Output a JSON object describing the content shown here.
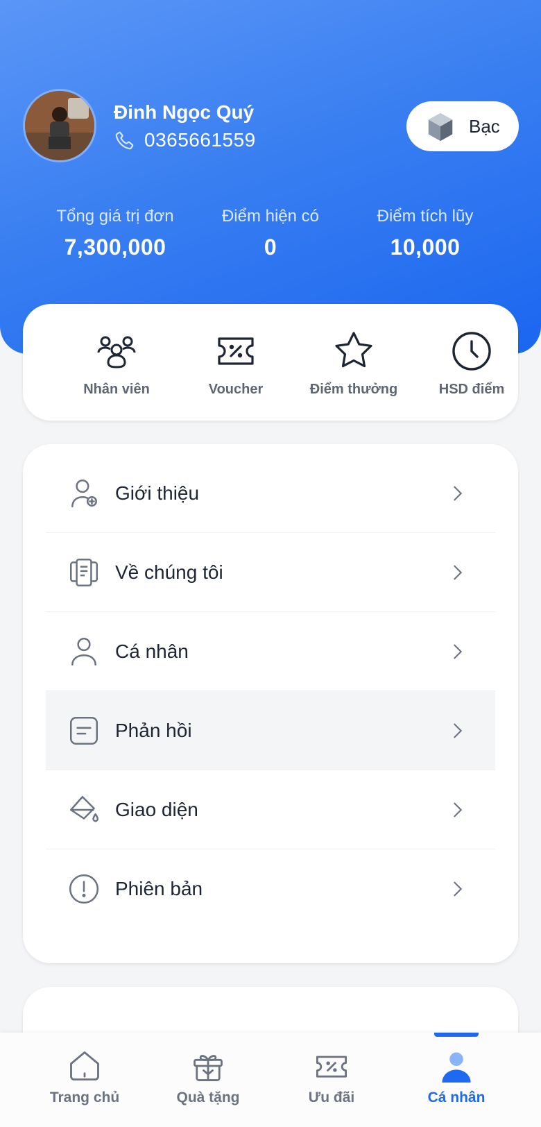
{
  "profile": {
    "name": "Đinh Ngọc Quý",
    "phone": "0365661559",
    "tier": "Bạc",
    "avatar_icon": "user-photo"
  },
  "stats": [
    {
      "label": "Tổng giá trị đơn",
      "value": "7,300,000"
    },
    {
      "label": "Điểm hiện có",
      "value": "0"
    },
    {
      "label": "Điểm tích lũy",
      "value": "10,000"
    }
  ],
  "quick_actions": [
    {
      "label": "Nhân viên",
      "icon": "people-icon"
    },
    {
      "label": "Voucher",
      "icon": "ticket-percent-icon"
    },
    {
      "label": "Điểm thưởng",
      "icon": "star-icon"
    },
    {
      "label": "HSD điểm",
      "icon": "clock-icon"
    }
  ],
  "menu": [
    {
      "label": "Giới thiệu",
      "icon": "user-add-icon"
    },
    {
      "label": "Về chúng tôi",
      "icon": "document-copy-icon"
    },
    {
      "label": "Cá nhân",
      "icon": "user-icon"
    },
    {
      "label": "Phản hồi",
      "icon": "note-icon"
    },
    {
      "label": "Giao diện",
      "icon": "paint-bucket-icon"
    },
    {
      "label": "Phiên bản",
      "icon": "info-circle-icon"
    }
  ],
  "bottom_nav": [
    {
      "label": "Trang chủ",
      "icon": "home-icon"
    },
    {
      "label": "Quà tặng",
      "icon": "gift-icon"
    },
    {
      "label": "Ưu đãi",
      "icon": "ticket-percent-icon"
    },
    {
      "label": "Cá nhân",
      "icon": "user-icon",
      "active": true
    }
  ],
  "colors": {
    "accent": "#1d6af0",
    "header_gradient_start": "#5a96f7",
    "header_gradient_end": "#1a66f0"
  }
}
